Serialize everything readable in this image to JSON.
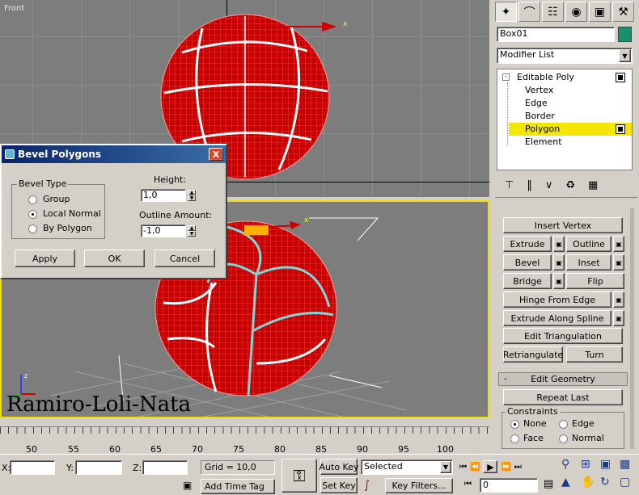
{
  "viewport_top": {
    "label": "Front"
  },
  "watermark": "Ramiro-Loli-Nata",
  "command_panel": {
    "object_name": "Box01",
    "object_color": "#1a8f6e",
    "modifier_list_label": "Modifier List",
    "stack": {
      "root": "Editable Poly",
      "items": [
        "Vertex",
        "Edge",
        "Border",
        "Polygon",
        "Element"
      ],
      "selected": "Polygon"
    },
    "edit_polygons_buttons": {
      "insert_vertex": "Insert Vertex",
      "extrude": "Extrude",
      "outline": "Outline",
      "bevel": "Bevel",
      "inset": "Inset",
      "bridge": "Bridge",
      "flip": "Flip",
      "hinge_from_edge": "Hinge From Edge",
      "extrude_along_spline": "Extrude Along Spline",
      "edit_triangulation": "Edit Triangulation",
      "retriangulate": "Retriangulate",
      "turn": "Turn"
    },
    "edit_geometry": {
      "collapse_sign": "-",
      "title": "Edit Geometry",
      "repeat_last": "Repeat Last",
      "constraints_label": "Constraints",
      "options": [
        "None",
        "Edge",
        "Face",
        "Normal"
      ],
      "selected": "None"
    }
  },
  "dialog": {
    "title": "Bevel Polygons",
    "bevel_type_label": "Bevel Type",
    "options": [
      "Group",
      "Local Normal",
      "By Polygon"
    ],
    "selected": "Local Normal",
    "height_label": "Height:",
    "height_value": "1,0",
    "outline_label": "Outline Amount:",
    "outline_value": "-1,0",
    "apply": "Apply",
    "ok": "OK",
    "cancel": "Cancel",
    "close_glyph": "X"
  },
  "ruler": {
    "ticks": [
      "50",
      "55",
      "60",
      "65",
      "70",
      "75",
      "80",
      "85",
      "90",
      "95",
      "100"
    ]
  },
  "status": {
    "x_label": "X:",
    "y_label": "Y:",
    "z_label": "Z:",
    "grid": "Grid = 10,0",
    "add_time_tag": "Add Time Tag",
    "auto_key": "Auto Key",
    "set_key": "Set Key",
    "key_filters": "Key Filters...",
    "selection": "Selected",
    "frame": "0"
  }
}
